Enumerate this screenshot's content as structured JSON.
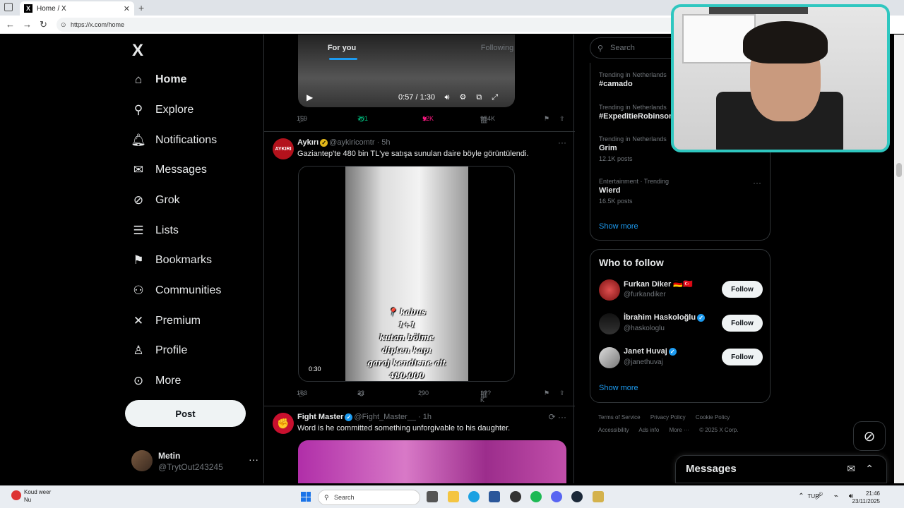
{
  "browser": {
    "tab_title": "Home / X",
    "url": "https://x.com/home"
  },
  "nav": {
    "brand": "X",
    "items": [
      {
        "label": "Home",
        "icon": "home-icon"
      },
      {
        "label": "Explore",
        "icon": "search-icon"
      },
      {
        "label": "Notifications",
        "icon": "bell-icon"
      },
      {
        "label": "Messages",
        "icon": "mail-icon"
      },
      {
        "label": "Grok",
        "icon": "grok-icon"
      },
      {
        "label": "Lists",
        "icon": "list-icon"
      },
      {
        "label": "Bookmarks",
        "icon": "bookmark-icon"
      },
      {
        "label": "Communities",
        "icon": "communities-icon"
      },
      {
        "label": "Premium",
        "icon": "x-icon"
      },
      {
        "label": "Profile",
        "icon": "person-icon"
      },
      {
        "label": "More",
        "icon": "more-circle-icon"
      }
    ],
    "post_label": "Post",
    "account": {
      "name": "Metin",
      "handle": "@TrytOut243245"
    }
  },
  "feed": {
    "tabs": [
      "For you",
      "Following"
    ],
    "video1": {
      "time": "0:57 / 1:30"
    },
    "tweet1_stats": {
      "replies": "159",
      "reposts": "701",
      "likes": "12K",
      "views": "954K"
    },
    "tweet2": {
      "name": "Aykırı",
      "handle": "@aykiricomtr",
      "time": "· 5h",
      "text": "Gaziantep'te 480 bin TL'ye satışa sunulan daire böyle görüntülendi.",
      "avatar_text": "AYKIRI",
      "overlay": [
        "📍 kabus",
        "1+1",
        "kutan bölme",
        "dipten kapı",
        "garaj kendisne ait",
        "480.000"
      ],
      "duration": "0:30",
      "replies": "163",
      "reposts": "22",
      "likes": "290",
      "views": "1??K"
    },
    "tweet3": {
      "name": "Fight Master",
      "handle": "@Fight_Master__",
      "time": "· 1h",
      "text": "Word is he committed something unforgivable to his daughter."
    }
  },
  "sidebar": {
    "search_placeholder": "Search",
    "trends": [
      {
        "meta": "Trending in Netherlands",
        "title": "#camado",
        "posts": ""
      },
      {
        "meta": "Trending in Netherlands",
        "title": "#ExpeditieRobinson",
        "posts": ""
      },
      {
        "meta": "Trending in Netherlands",
        "title": "Grim",
        "posts": "12.1K posts"
      },
      {
        "meta": "Entertainment · Trending",
        "title": "Wierd",
        "posts": "16.5K posts"
      }
    ],
    "show_more": "Show more",
    "who_to_follow": {
      "title": "Who to follow",
      "people": [
        {
          "name": "Furkan Diker 🇩🇪🇹🇷",
          "handle": "@furkandiker",
          "button": "Follow"
        },
        {
          "name": "İbrahim Haskoloğlu",
          "handle": "@haskologlu",
          "button": "Follow"
        },
        {
          "name": "Janet Huvaj",
          "handle": "@janethuvaj",
          "button": "Follow"
        }
      ],
      "show_more": "Show more"
    },
    "footer": [
      "Terms of Service",
      "Privacy Policy",
      "Cookie Policy",
      "Accessibility",
      "Ads info",
      "More ···",
      "© 2025 X Corp."
    ]
  },
  "messages_dock": {
    "title": "Messages"
  },
  "taskbar": {
    "weather_title": "Koud weer",
    "weather_sub": "Nu",
    "search": "Search",
    "lang": "TUR",
    "time": "21:46",
    "date": "23/11/2025"
  }
}
